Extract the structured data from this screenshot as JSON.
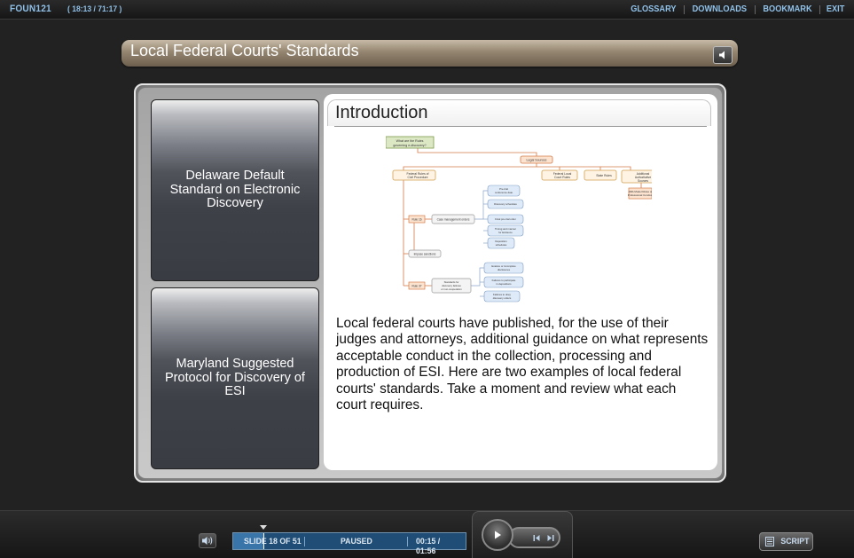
{
  "topbar": {
    "course_code": "FOUN121",
    "course_time": "( 18:13 / 71:17 )",
    "nav": [
      "GLOSSARY",
      "DOWNLOADS",
      "BOOKMARK",
      "EXIT"
    ]
  },
  "slide": {
    "title": "Local Federal Courts' Standards",
    "tabs": [
      "Delaware Default Standard on Electronic Discovery",
      "Maryland Suggested Protocol for Discovery of ESI"
    ],
    "content": {
      "heading": "Introduction",
      "body": "Local federal courts have published, for the use of their judges and attorneys, additional guidance on what represents acceptable conduct in the collection, processing and production of ESI.  Here are two examples of local federal courts' standards. Take a moment and review what each court requires."
    },
    "diagram": {
      "root": "What are the Rules governing e-discovery?",
      "legal_sources": "Legal Sources",
      "sources": [
        "Federal Rules of Civil Procedure",
        "Federal Local Court Rules",
        "State Rules",
        "Additional Authoritative Sources"
      ],
      "aba": "ABA Model Rules of Professional Conduct",
      "rule16": "Rule 16",
      "rule37": "Rule 37",
      "case_mgmt": "Case management orders",
      "case_mgmt_items": [
        "Pre-trial conference date",
        "Discovery schedules",
        "Final pre-trial order",
        "Timing and manner for Evidence",
        "Deposition schedules"
      ],
      "impose_sanctions": "Impose sanctions",
      "standards": "Standards for discovery failures or non-cooperation",
      "standards_items": [
        "Evasive or incomplete disclosures",
        "Failures to participate in depositions",
        "Failures to obey discovery orders"
      ]
    }
  },
  "player": {
    "slide_indicator": "SLIDE 18 OF 51",
    "status": "PAUSED",
    "time": "00:15 / 01:56",
    "progress": 0.13,
    "script_label": "SCRIPT"
  },
  "colors": {
    "accent_text": "#8fc0e8",
    "progress_bg": "#1f4d75",
    "title_bar": "#948570"
  }
}
